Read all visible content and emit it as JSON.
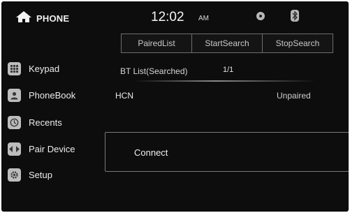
{
  "status_bar": {
    "app_title": "PHONE",
    "time": "12:02",
    "ampm": "AM"
  },
  "tabs": [
    {
      "label": "PairedList"
    },
    {
      "label": "StartSearch"
    },
    {
      "label": "StopSearch"
    }
  ],
  "sidebar": {
    "items": [
      {
        "label": "Keypad",
        "icon": "keypad-icon"
      },
      {
        "label": "PhoneBook",
        "icon": "contact-icon"
      },
      {
        "label": "Recents",
        "icon": "clock-icon"
      },
      {
        "label": "Pair Device",
        "icon": "pair-arrows-icon"
      },
      {
        "label": "Setup",
        "icon": "gear-icon"
      }
    ]
  },
  "bt_list": {
    "header": "BT List(Searched)",
    "page": "1/1",
    "devices": [
      {
        "name": "HCN",
        "status": "Unpaired"
      }
    ]
  },
  "action_panel": {
    "label": "Connect"
  }
}
